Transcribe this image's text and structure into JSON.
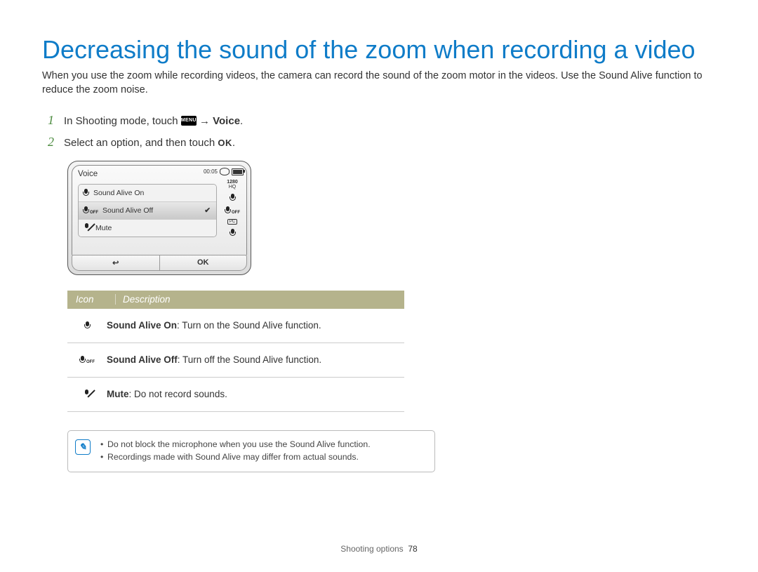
{
  "title": "Decreasing the sound of the zoom when recording a video",
  "intro": "When you use the zoom while recording videos, the camera can record the sound of the zoom motor in the videos. Use the Sound Alive function to reduce the zoom noise.",
  "steps": {
    "s1_pre": "In Shooting mode, touch ",
    "s1_menu": "MENU",
    "s1_arrow": " → ",
    "s1_post": "Voice",
    "s1_post_dot": ".",
    "s2_pre": "Select an option, and then touch ",
    "s2_ok": "OK",
    "s2_dot": "."
  },
  "screenshot": {
    "title": "Voice",
    "timelabel": "00:05",
    "res": "1280",
    "hq": "HQ",
    "items": [
      {
        "label": "Sound Alive On",
        "icon": "mic",
        "selected": false
      },
      {
        "label": "Sound Alive Off",
        "icon": "mic-off",
        "selected": true
      },
      {
        "label": "Mute",
        "icon": "mic-mute",
        "selected": false
      }
    ],
    "off_txt": "OFF",
    "back": "↩",
    "ok": "OK"
  },
  "legend": {
    "head_icon": "Icon",
    "head_desc": "Description",
    "rows": [
      {
        "icon": "mic",
        "label": "Sound Alive On",
        "desc": ": Turn on the Sound Alive function."
      },
      {
        "icon": "mic-off",
        "label": "Sound Alive Off",
        "desc": ": Turn off the Sound Alive function."
      },
      {
        "icon": "mic-mute",
        "label": "Mute",
        "desc": ": Do not record sounds."
      }
    ]
  },
  "notes": [
    "Do not block the microphone when you use the Sound Alive function.",
    "Recordings made with Sound Alive may differ from actual sounds."
  ],
  "footer": {
    "section": "Shooting options",
    "page": "78"
  }
}
